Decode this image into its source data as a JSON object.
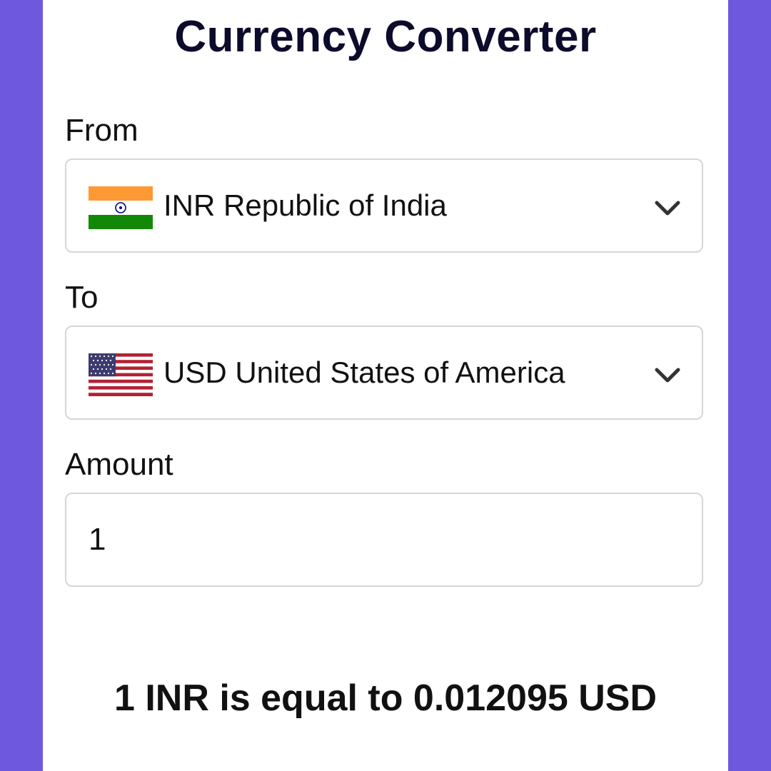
{
  "app": {
    "title": "Currency Converter"
  },
  "from": {
    "label": "From",
    "code": "INR",
    "country": "Republic of India",
    "display": "INR Republic of India",
    "flag_icon": "india-flag-icon"
  },
  "to": {
    "label": "To",
    "code": "USD",
    "country": "United States of America",
    "display": "USD United States of America",
    "flag_icon": "usa-flag-icon"
  },
  "amount": {
    "label": "Amount",
    "value": "1"
  },
  "result": {
    "text": "1 INR is equal to 0.012095 USD"
  },
  "colors": {
    "background": "#6e58de",
    "card": "#ffffff",
    "title": "#0d0b2b",
    "border": "#d6d6d6"
  }
}
